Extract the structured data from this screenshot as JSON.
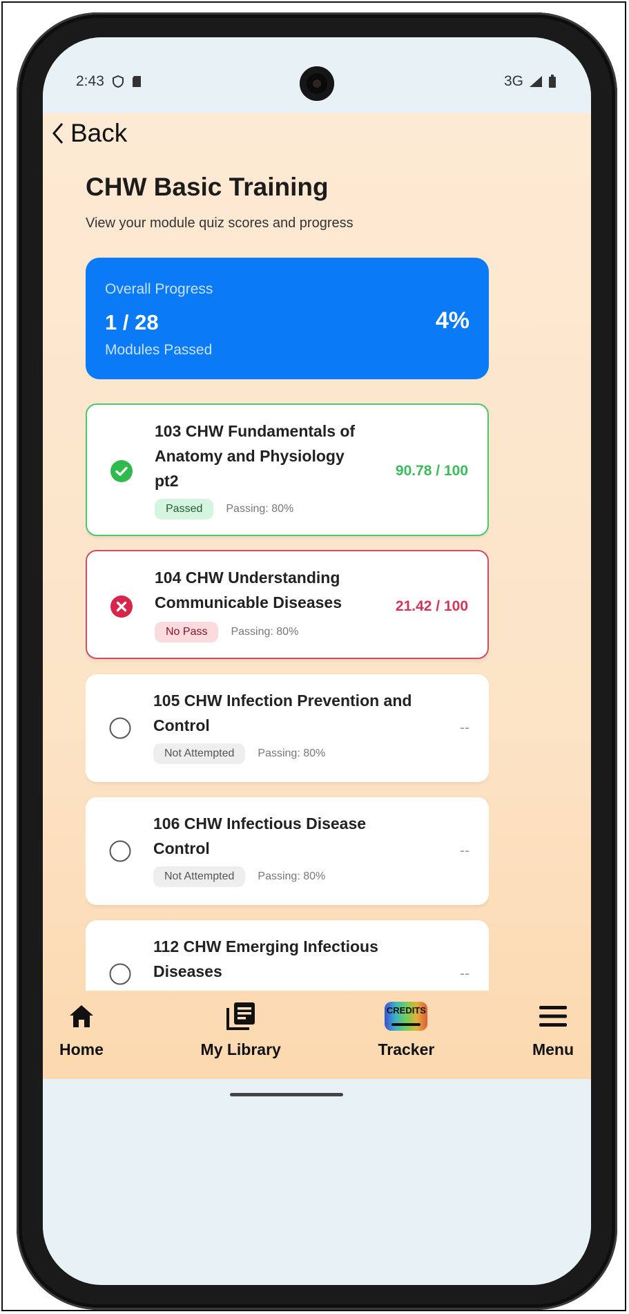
{
  "status_bar": {
    "time": "2:43",
    "network": "3G"
  },
  "header": {
    "back_label": "Back"
  },
  "page": {
    "title": "CHW Basic Training",
    "subtitle": "View your module quiz scores and progress"
  },
  "overall_progress": {
    "label": "Overall Progress",
    "count": "1 / 28",
    "sub_label": "Modules Passed",
    "percent": "4%"
  },
  "modules": [
    {
      "title": "103 CHW Fundamentals of Anatomy and Physiology pt2",
      "status": "Passed",
      "passing": "Passing: 80%",
      "score": "90.78 / 100"
    },
    {
      "title": "104 CHW Understanding Communicable Diseases",
      "status": "No Pass",
      "passing": "Passing: 80%",
      "score": "21.42 / 100"
    },
    {
      "title": "105 CHW Infection Prevention and Control",
      "status": "Not Attempted",
      "passing": "Passing: 80%",
      "score": "--"
    },
    {
      "title": "106 CHW Infectious Disease Control",
      "status": "Not Attempted",
      "passing": "Passing: 80%",
      "score": "--"
    },
    {
      "title": "112 CHW Emerging Infectious Diseases",
      "score": "--"
    }
  ],
  "bottom_nav": {
    "home": "Home",
    "library": "My Library",
    "tracker": "Tracker",
    "tracker_icon_text": "CREDITS",
    "menu": "Menu"
  },
  "colors": {
    "accent_blue": "#0a7af6",
    "pass_green": "#3dbb59",
    "fail_red": "#d2355a",
    "background_peach": "#fce3c6"
  }
}
